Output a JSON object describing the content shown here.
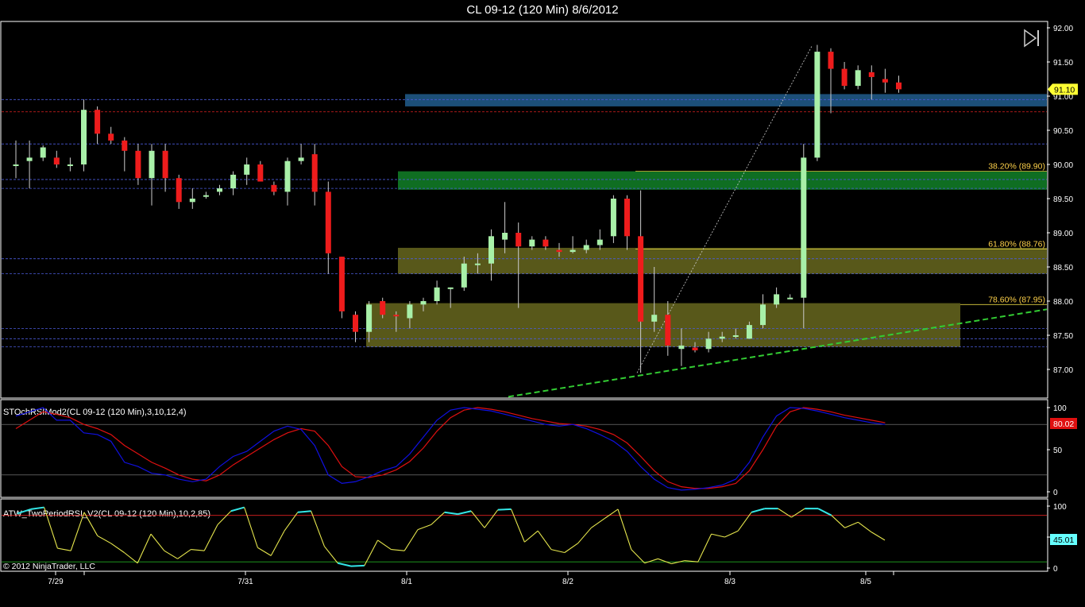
{
  "chart_title": "CL 09-12 (120 Min)  8/6/2012",
  "copyright": "© 2012 NinjaTrader, LLC",
  "colors": {
    "background": "#000000",
    "up_candle": "#a8f0a8",
    "down_candle": "#ee1c1c",
    "blue_zone": "#1c4f78",
    "green_zone": "#0f6e22",
    "olive_zone": "#58581a",
    "trendline": "#33cc33",
    "stoch_k": "#1010e0",
    "stoch_d": "#e01010",
    "rsi_line": "#e6e64d",
    "rsi_extreme": "#33e6e6",
    "price_tag": "#ffff33",
    "stoch_tag": "#e01010",
    "rsi_tag": "#66ffff"
  },
  "chart_data": {
    "type": "candlestick",
    "instrument": "CL 09-12",
    "interval": "120 Min",
    "x_labels": [
      "7/29",
      "7/31",
      "8/1",
      "8/2",
      "8/3",
      "8/5"
    ],
    "y_axis": {
      "ticks": [
        "92.00",
        "91.50",
        "91.00",
        "90.50",
        "90.00",
        "89.50",
        "89.00",
        "88.50",
        "88.00",
        "87.50",
        "87.00"
      ],
      "ylim": [
        86.6,
        92.1
      ]
    },
    "candles": [
      {
        "o": 90.0,
        "h": 90.35,
        "l": 89.8,
        "c": 90.0
      },
      {
        "o": 90.05,
        "h": 90.35,
        "l": 89.65,
        "c": 90.1
      },
      {
        "o": 90.1,
        "h": 90.28,
        "l": 90.05,
        "c": 90.25
      },
      {
        "o": 90.1,
        "h": 90.2,
        "l": 89.95,
        "c": 90.0
      },
      {
        "o": 90.0,
        "h": 90.1,
        "l": 89.9,
        "c": 90.0
      },
      {
        "o": 90.0,
        "h": 90.95,
        "l": 89.9,
        "c": 90.8
      },
      {
        "o": 90.8,
        "h": 90.85,
        "l": 90.3,
        "c": 90.45
      },
      {
        "o": 90.45,
        "h": 90.55,
        "l": 90.3,
        "c": 90.35
      },
      {
        "o": 90.35,
        "h": 90.4,
        "l": 89.9,
        "c": 90.2
      },
      {
        "o": 90.2,
        "h": 90.3,
        "l": 89.7,
        "c": 89.8
      },
      {
        "o": 89.8,
        "h": 90.3,
        "l": 89.4,
        "c": 90.2
      },
      {
        "o": 90.2,
        "h": 90.3,
        "l": 89.6,
        "c": 89.8
      },
      {
        "o": 89.8,
        "h": 89.85,
        "l": 89.35,
        "c": 89.45
      },
      {
        "o": 89.45,
        "h": 89.65,
        "l": 89.35,
        "c": 89.5
      },
      {
        "o": 89.55,
        "h": 89.6,
        "l": 89.5,
        "c": 89.55
      },
      {
        "o": 89.6,
        "h": 89.7,
        "l": 89.55,
        "c": 89.65
      },
      {
        "o": 89.65,
        "h": 89.9,
        "l": 89.55,
        "c": 89.85
      },
      {
        "o": 89.85,
        "h": 90.1,
        "l": 89.7,
        "c": 90.0
      },
      {
        "o": 90.0,
        "h": 90.05,
        "l": 89.75,
        "c": 89.75
      },
      {
        "o": 89.7,
        "h": 89.75,
        "l": 89.55,
        "c": 89.6
      },
      {
        "o": 89.6,
        "h": 90.1,
        "l": 89.4,
        "c": 90.05
      },
      {
        "o": 90.05,
        "h": 90.3,
        "l": 90.0,
        "c": 90.1
      },
      {
        "o": 90.15,
        "h": 90.3,
        "l": 89.4,
        "c": 89.6
      },
      {
        "o": 89.6,
        "h": 89.75,
        "l": 88.4,
        "c": 88.7
      },
      {
        "o": 88.65,
        "h": 88.65,
        "l": 87.75,
        "c": 87.85
      },
      {
        "o": 87.8,
        "h": 87.85,
        "l": 87.4,
        "c": 87.55
      },
      {
        "o": 87.55,
        "h": 88.0,
        "l": 87.4,
        "c": 87.95
      },
      {
        "o": 88.0,
        "h": 88.05,
        "l": 87.75,
        "c": 87.8
      },
      {
        "o": 87.8,
        "h": 87.85,
        "l": 87.55,
        "c": 87.78
      },
      {
        "o": 87.75,
        "h": 88.0,
        "l": 87.6,
        "c": 87.95
      },
      {
        "o": 87.95,
        "h": 88.05,
        "l": 87.85,
        "c": 88.0
      },
      {
        "o": 88.0,
        "h": 88.3,
        "l": 87.95,
        "c": 88.2
      },
      {
        "o": 88.2,
        "h": 88.2,
        "l": 87.9,
        "c": 88.2
      },
      {
        "o": 88.2,
        "h": 88.65,
        "l": 88.15,
        "c": 88.55
      },
      {
        "o": 88.55,
        "h": 88.7,
        "l": 88.4,
        "c": 88.55
      },
      {
        "o": 88.55,
        "h": 89.05,
        "l": 88.3,
        "c": 88.95
      },
      {
        "o": 88.9,
        "h": 89.45,
        "l": 88.7,
        "c": 89.0
      },
      {
        "o": 89.0,
        "h": 89.15,
        "l": 87.9,
        "c": 88.8
      },
      {
        "o": 88.8,
        "h": 88.95,
        "l": 88.75,
        "c": 88.9
      },
      {
        "o": 88.9,
        "h": 88.95,
        "l": 88.75,
        "c": 88.8
      },
      {
        "o": 88.75,
        "h": 88.85,
        "l": 88.65,
        "c": 88.72
      },
      {
        "o": 88.72,
        "h": 88.95,
        "l": 88.7,
        "c": 88.75
      },
      {
        "o": 88.75,
        "h": 88.9,
        "l": 88.7,
        "c": 88.82
      },
      {
        "o": 88.82,
        "h": 89.05,
        "l": 88.75,
        "c": 88.9
      },
      {
        "o": 88.95,
        "h": 89.55,
        "l": 88.85,
        "c": 89.5
      },
      {
        "o": 89.5,
        "h": 89.55,
        "l": 88.75,
        "c": 88.95
      },
      {
        "o": 88.95,
        "h": 89.62,
        "l": 86.95,
        "c": 87.7
      },
      {
        "o": 87.7,
        "h": 88.5,
        "l": 87.55,
        "c": 87.8
      },
      {
        "o": 87.8,
        "h": 88.0,
        "l": 87.2,
        "c": 87.35
      },
      {
        "o": 87.3,
        "h": 87.6,
        "l": 87.05,
        "c": 87.35
      },
      {
        "o": 87.32,
        "h": 87.4,
        "l": 87.25,
        "c": 87.28
      },
      {
        "o": 87.3,
        "h": 87.55,
        "l": 87.25,
        "c": 87.45
      },
      {
        "o": 87.45,
        "h": 87.55,
        "l": 87.4,
        "c": 87.48
      },
      {
        "o": 87.48,
        "h": 87.6,
        "l": 87.45,
        "c": 87.5
      },
      {
        "o": 87.45,
        "h": 87.7,
        "l": 87.45,
        "c": 87.65
      },
      {
        "o": 87.65,
        "h": 88.1,
        "l": 87.6,
        "c": 87.95
      },
      {
        "o": 87.95,
        "h": 88.2,
        "l": 87.9,
        "c": 88.1
      },
      {
        "o": 88.05,
        "h": 88.1,
        "l": 88.03,
        "c": 88.05
      },
      {
        "o": 88.05,
        "h": 90.3,
        "l": 87.6,
        "c": 90.1
      },
      {
        "o": 90.1,
        "h": 91.75,
        "l": 90.05,
        "c": 91.65
      },
      {
        "o": 91.65,
        "h": 91.7,
        "l": 90.75,
        "c": 91.4
      },
      {
        "o": 91.4,
        "h": 91.5,
        "l": 91.1,
        "c": 91.15
      },
      {
        "o": 91.15,
        "h": 91.45,
        "l": 91.1,
        "c": 91.38
      },
      {
        "o": 91.35,
        "h": 91.45,
        "l": 90.95,
        "c": 91.28
      },
      {
        "o": 91.25,
        "h": 91.4,
        "l": 91.05,
        "c": 91.2
      },
      {
        "o": 91.2,
        "h": 91.3,
        "l": 91.05,
        "c": 91.1
      }
    ],
    "fib_levels": [
      {
        "label": "38.20% (89.90)",
        "value": 89.9
      },
      {
        "label": "61.80% (88.76)",
        "value": 88.76
      },
      {
        "label": "78.60% (87.95)",
        "value": 87.95
      }
    ],
    "zones": [
      {
        "name": "blue",
        "from": 90.85,
        "to": 91.03
      },
      {
        "name": "green",
        "from": 89.63,
        "to": 89.9
      },
      {
        "name": "olive-upper",
        "from": 88.4,
        "to": 88.78
      },
      {
        "name": "olive-lower",
        "from": 87.33,
        "to": 87.97
      }
    ],
    "horizontal_lines_blue": [
      90.95,
      90.3,
      89.78,
      89.65,
      88.62,
      88.4,
      87.6,
      87.45,
      87.33
    ],
    "horizontal_line_red": 90.77,
    "trendline": {
      "from": 86.6,
      "to": 87.88
    },
    "current_price_label": "91.10",
    "stoch_panel": {
      "title": "STOchRSIMod2(CL 09-12 (120 Min),3,10,12,4)",
      "ticks": [
        "100",
        "50",
        "0"
      ],
      "current_label": "80.02",
      "k": [
        90,
        95,
        100,
        85,
        85,
        70,
        68,
        60,
        35,
        30,
        22,
        20,
        15,
        12,
        15,
        30,
        42,
        48,
        60,
        72,
        78,
        74,
        55,
        20,
        10,
        12,
        18,
        25,
        30,
        45,
        65,
        85,
        97,
        100,
        98,
        96,
        92,
        88,
        84,
        80,
        78,
        80,
        75,
        68,
        60,
        48,
        30,
        15,
        5,
        2,
        3,
        5,
        8,
        15,
        35,
        65,
        90,
        100,
        99,
        96,
        92,
        88,
        85,
        82,
        80
      ],
      "d": [
        75,
        85,
        95,
        92,
        88,
        80,
        75,
        68,
        55,
        45,
        35,
        28,
        20,
        15,
        13,
        20,
        32,
        42,
        52,
        62,
        70,
        75,
        72,
        55,
        30,
        18,
        17,
        20,
        26,
        36,
        52,
        72,
        88,
        97,
        100,
        98,
        95,
        91,
        87,
        84,
        81,
        80,
        78,
        74,
        68,
        58,
        42,
        25,
        12,
        6,
        4,
        4,
        6,
        10,
        25,
        50,
        78,
        95,
        100,
        98,
        95,
        91,
        88,
        85,
        82
      ]
    },
    "rsi_panel": {
      "title": "ATW_TwoPeriodRSI_V2(CL 09-12 (120 Min),10,2,85)",
      "ticks": [
        "100",
        "50",
        "0"
      ],
      "current_label": "45.01",
      "values": [
        88,
        95,
        98,
        32,
        28,
        90,
        52,
        40,
        25,
        8,
        55,
        28,
        15,
        30,
        28,
        70,
        92,
        98,
        33,
        20,
        60,
        90,
        92,
        35,
        8,
        3,
        4,
        45,
        30,
        28,
        62,
        70,
        90,
        87,
        92,
        65,
        94,
        95,
        42,
        60,
        30,
        25,
        40,
        65,
        80,
        95,
        30,
        8,
        15,
        7,
        12,
        10,
        55,
        50,
        60,
        90,
        96,
        96,
        82,
        96,
        96,
        85,
        65,
        74,
        58,
        45
      ]
    }
  }
}
